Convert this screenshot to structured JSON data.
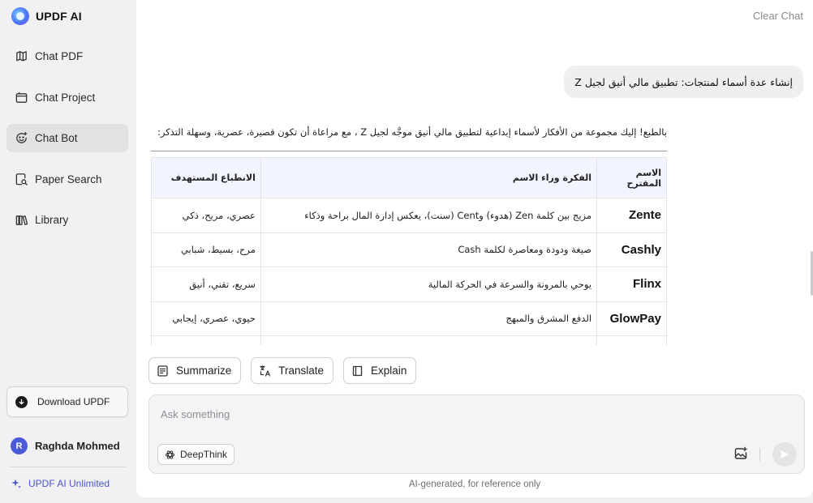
{
  "app": {
    "name": "UPDF AI"
  },
  "sidebar": {
    "items": [
      {
        "label": "Chat PDF",
        "icon": "chat-pdf-icon"
      },
      {
        "label": "Chat Project",
        "icon": "chat-project-icon"
      },
      {
        "label": "Chat Bot",
        "icon": "chat-bot-icon",
        "active": true
      },
      {
        "label": "Paper Search",
        "icon": "paper-search-icon"
      },
      {
        "label": "Library",
        "icon": "library-icon"
      }
    ],
    "download_label": "Download UPDF",
    "user": {
      "initial": "R",
      "name": "Raghda Mohmed"
    },
    "unlimited_label": "UPDF AI Unlimited"
  },
  "header": {
    "clear_chat": "Clear Chat"
  },
  "conversation": {
    "user_message": "إنشاء عدة أسماء لمنتجات: تطبيق مالي أنيق لجيل Z",
    "reply_intro": "بالطبع! إليك مجموعة من الأفكار لأسماء إبداعية لتطبيق مالي أنيق موجَّه لجيل Z ، مع مراعاة أن تكون قصيرة، عصرية، وسهلة التذكر:",
    "table": {
      "headers": [
        "الاسم المقترح",
        "الفكرة وراء الاسم",
        "الانطباع المستهدف"
      ],
      "rows": [
        [
          "Zente",
          "مزيج بين كلمة Zen (هدوء) وCent (سنت)، يعكس إدارة المال براحة وذكاء",
          "عصري، مريح، ذكي"
        ],
        [
          "Cashly",
          "صيغة ودودة ومعاصرة لكلمة Cash",
          "مرح، بسيط، شبابي"
        ],
        [
          "Flinx",
          "يوحي بالمرونة والسرعة في الحركة المالية",
          "سريع، تقني، أنيق"
        ],
        [
          "GlowPay",
          "الدفع المشرق والمبهج",
          "حيوي، عصري، إيجابي"
        ]
      ]
    }
  },
  "actions": {
    "summarize": "Summarize",
    "translate": "Translate",
    "explain": "Explain"
  },
  "composer": {
    "placeholder": "Ask something",
    "deepthink_label": "DeepThink"
  },
  "footer": {
    "note": "AI-generated, for reference only"
  },
  "colors": {
    "accent": "#4b55c9",
    "avatar": "#4b5ad6",
    "table_header": "#f2f4ff"
  }
}
